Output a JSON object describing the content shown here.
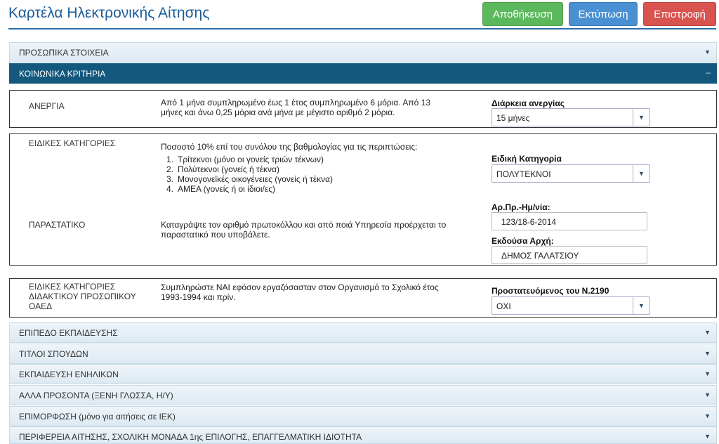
{
  "header": {
    "title": "Καρτέλα Ηλεκτρονικής Αίτησης",
    "save_label": "Αποθήκευση",
    "print_label": "Εκτύπωση",
    "back_label": "Επιστροφή"
  },
  "sections": {
    "personal": "ΠΡΟΣΩΠΙΚΑ ΣΤΟΙΧΕΙΑ",
    "social": "ΚΟΙΝΩΝΙΚΑ ΚΡΙΤΗΡΙΑ",
    "education_level": "ΕΠΙΠΕΔΟ ΕΚΠΑΙΔΕΥΣΗΣ",
    "degrees": "ΤΙΤΛΟΙ ΣΠΟΥΔΩΝ",
    "adult_education": "ΕΚΠΑΙΔΕΥΣΗ ΕΝΗΛΙΚΩΝ",
    "other_skills": "ΑΛΛΑ ΠΡΟΣΟΝΤΑ (ΞΕΝΗ ΓΛΩΣΣΑ, Η/Υ)",
    "training": "ΕΠΙΜΟΡΦΩΣΗ (μόνο για αιτήσεις σε ΙΕΚ)",
    "region": "ΠΕΡΙΦΕΡΕΙΑ ΑΙΤΗΣΗΣ, ΣΧΟΛΙΚΗ ΜΟΝΑΔΑ 1ης ΕΠΙΛΟΓΗΣ, ΕΠΑΓΓΕΛΜΑΤΙΚΗ ΙΔΙΟΤΗΤΑ"
  },
  "unemployment": {
    "label": "ΑΝΕΡΓΙΑ",
    "desc_line1": "Από 1 μήνα συμπληρωμένο έως 1 έτος συμπληρωμένο 6 μόρια. Από 13",
    "desc_line2": "μήνες και άνω 0,25 μόρια ανά μήνα με μέγιστο αριθμό 2 μόρια.",
    "field_label": "Διάρκεια ανεργίας",
    "value": "15 μήνες"
  },
  "special": {
    "label": "ΕΙΔΙΚΕΣ ΚΑΤΗΓΟΡΙΕΣ",
    "desc": "Ποσοστό 10% επί του συνόλου της βαθμολογίας για τις περιπτώσεις:",
    "items": [
      "Τρίτεκνοι (μόνο οι γονείς τριών τέκνων)",
      "Πολύτεκνοι (γονείς ή τέκνα)",
      "Μονογονεϊκές οικογένειες (γονείς ή τέκνα)",
      "ΑΜΕΑ (γονείς ή οι ίδιοι/ες)"
    ],
    "field_label": "Ειδική Κατηγορία",
    "value": "ΠΟΛΥΤΕΚΝΟΙ"
  },
  "document": {
    "label": "ΠΑΡΑΣΤΑΤΙΚΟ",
    "desc_line1": "Καταγράψτε τον αριθμό πρωτοκόλλου και από ποιά Υπηρεσία προέρχεται το",
    "desc_line2": "παραστατικό που υποβάλετε.",
    "protocol_label": "Αρ.Πρ.-Ημ/νία:",
    "protocol_value": "123/18-6-2014",
    "authority_label": "Εκδούσα Αρχή:",
    "authority_value": "ΔΗΜΟΣ ΓΑΛΑΤΣΙΟΥ"
  },
  "oaed": {
    "label_line1": "ΕΙΔΙΚΕΣ ΚΑΤΗΓΟΡΙΕΣ",
    "label_line2": "ΔΙΔΑΚΤΙΚΟΥ ΠΡΟΣΩΠΙΚΟΥ",
    "label_line3": "ΟΑΕΔ",
    "desc_line1": "Συμπληρώστε ΝΑΙ εφόσον εργαζόσασταν στον Οργανισμό το Σχολικό έτος",
    "desc_line2": "1993-1994 και πρίν.",
    "field_label": "Προστατευόμενος του Ν.2190",
    "value": "ΟΧΙ"
  },
  "icons": {
    "collapsed_arrow": "▼",
    "expanded_arrow": "–",
    "select_arrow": "▼"
  },
  "colors": {
    "title": "#1a5d99",
    "save": "#5cb85c",
    "print": "#4a90d2",
    "back": "#d9534f",
    "active_section": "#14587e"
  }
}
